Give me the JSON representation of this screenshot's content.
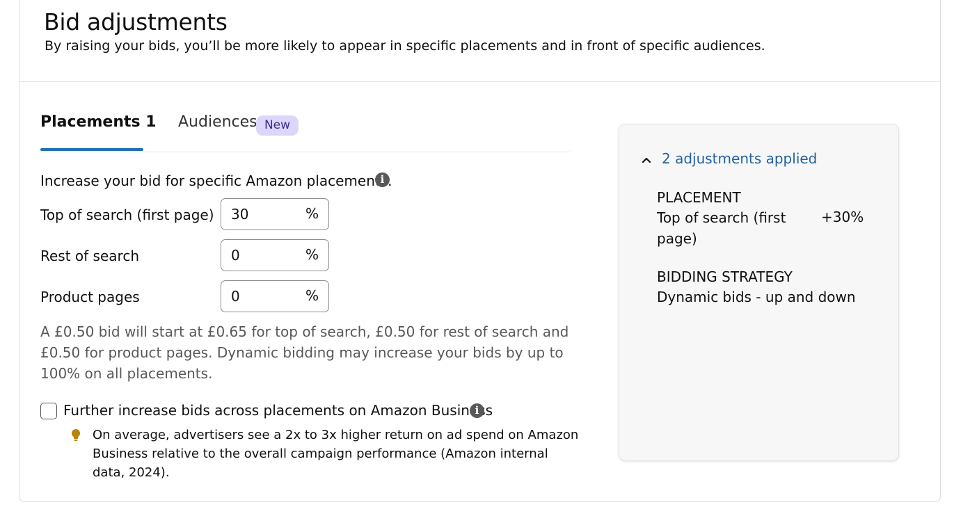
{
  "header": {
    "title": "Bid adjustments",
    "subtitle": "By raising your bids, you’ll be more likely to appear in specific placements and in front of specific audiences."
  },
  "tabs": [
    {
      "label": "Placements 1",
      "active": true
    },
    {
      "label": "Audiences",
      "badge": "New",
      "active": false
    }
  ],
  "placements": {
    "intro": "Increase your bid for specific Amazon placements.",
    "rows": [
      {
        "label": "Top of search (first page)",
        "value": "30",
        "unit": "%"
      },
      {
        "label": "Rest of search",
        "value": "0",
        "unit": "%"
      },
      {
        "label": "Product pages",
        "value": "0",
        "unit": "%"
      }
    ],
    "explanation": "A £0.50 bid will start at £0.65 for top of search, £0.50 for rest of search and £0.50 for product pages. Dynamic bidding may increase your bids by up to 100% on all placements.",
    "business_checkbox": {
      "label": "Further increase bids across placements on Amazon Business",
      "checked": false
    },
    "tip": "On average, advertisers see a 2x to 3x higher return on ad spend on Amazon Business relative to the overall campaign performance (Amazon internal data, 2024)."
  },
  "summary": {
    "toggle_label": "2 adjustments applied",
    "placement_heading": "PLACEMENT",
    "placement_name": "Top of search (first page)",
    "placement_value": "+30%",
    "strategy_heading": "BIDDING STRATEGY",
    "strategy_value": "Dynamic bids - up and down"
  },
  "colors": {
    "tab_underline": "#2170b5",
    "link": "#2162a1",
    "badge_bg": "#dcd6fb",
    "panel_bg": "#f7f7f7",
    "info_icon": "#595959",
    "bulb_icon": "#b7860b"
  },
  "icons": [
    "info-icon",
    "chevron-up-icon",
    "lightbulb-icon",
    "checkbox"
  ]
}
